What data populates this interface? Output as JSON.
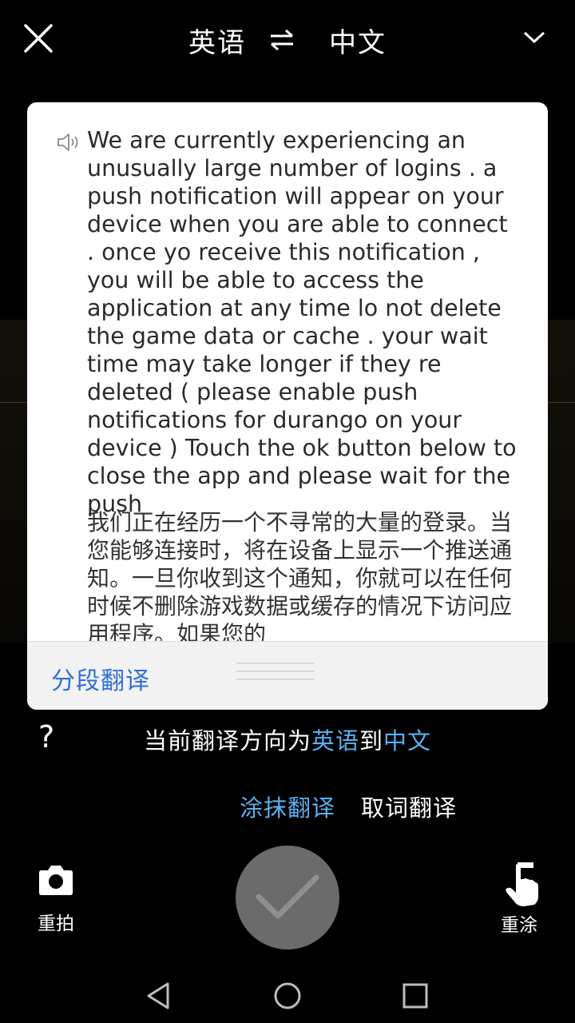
{
  "topbar": {
    "source_lang": "英语",
    "target_lang": "中文",
    "icons": [
      "close-icon",
      "swap-arrows-icon",
      "chevron-down-icon"
    ]
  },
  "card": {
    "source_text": "We are currently experiencing an unusually large number of logins . a push notification will appear on your device when you are able to connect . once yo receive this notification , you will be able to access the application at any time lo not delete the game data or cache . your wait time may take longer if they re deleted ( please enable push notifications for durango on your device ) Touch the ok button below to close the app and please wait for the push",
    "translated_text": "我们正在经历一个不寻常的大量的登录。当您能够连接时，将在设备上显示一个推送通知。一旦你收到这个通知，你就可以在任何时候不删除游戏数据或缓存的情况下访问应用程序。如果您的",
    "segment_translate_label": "分段翻译"
  },
  "direction": {
    "prefix": "当前翻译方向为",
    "source": "英语",
    "connector": "到",
    "target": "中文",
    "help_symbol": "?"
  },
  "modes": {
    "smear_translate": "涂抹翻译",
    "word_translate": "取词翻译",
    "active": "smear_translate"
  },
  "actions": {
    "retake_label": "重拍",
    "repaint_label": "重涂"
  },
  "colors": {
    "accent": "#59b1ef",
    "link_blue": "#2f6fd6",
    "confirm_button": "#6b6b6b"
  }
}
